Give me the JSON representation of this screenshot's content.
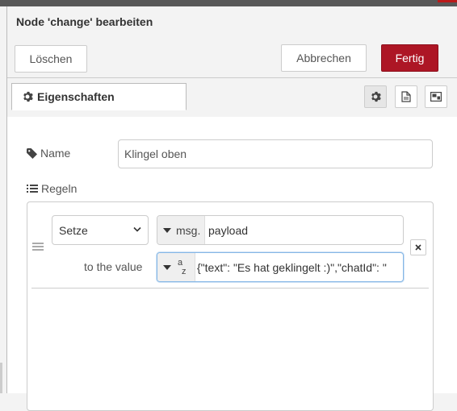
{
  "header": {
    "title": "Node 'change' bearbeiten",
    "delete_label": "Löschen",
    "cancel_label": "Abbrechen",
    "done_label": "Fertig"
  },
  "tabs": {
    "properties_label": "Eigenschaften",
    "icons": [
      "gear-icon",
      "document-icon",
      "appearance-icon"
    ]
  },
  "form": {
    "name_label": "Name",
    "name_value": "Klingel oben",
    "rules_label": "Regeln"
  },
  "rule": {
    "action": "Setze",
    "target_type": "msg.",
    "target_value": "payload",
    "to_label": "to the value",
    "value_type_glyph_top": "a",
    "value_type_glyph_bottom": "z",
    "value": "{\"text\": \"Es hat geklingelt :)\",\"chatId\": \""
  },
  "colors": {
    "accent": "#ad1625",
    "border": "#cccccc",
    "focus": "#85b7e6"
  }
}
